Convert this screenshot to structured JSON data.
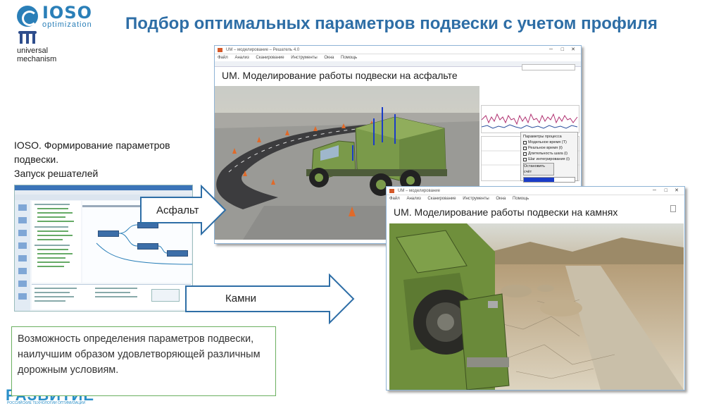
{
  "header": {
    "title": "Подбор оптимальных параметров подвески с учетом профиля",
    "ioso_logo_name": "IOSO",
    "ioso_logo_sub": "optimization",
    "um_logo_text": [
      "universal",
      "mechanism"
    ]
  },
  "left": {
    "caption": [
      "IOSO. Формирование параметров",
      "подвески.",
      "Запуск решателей"
    ]
  },
  "arrows": {
    "asphalt_label": "Асфальт",
    "stones_label": "Камни"
  },
  "window_asphalt": {
    "titlebar": "UM – моделирование – Решатель 4.0",
    "menu": [
      "Файл",
      "Анализ",
      "Сканирование",
      "Инструменты",
      "Окна",
      "Помощь"
    ],
    "banner": "UM. Моделирование работы подвески на асфальте",
    "panel_title": "Параметры процесса",
    "panel_items": [
      "Модельное время (T)",
      "Реальное время (t)",
      "Длительность шага (i)",
      "Шаг интегрирования (i)"
    ],
    "stop_button": "Остановить счёт",
    "progress_percent": 60,
    "progress_text": "60%"
  },
  "window_stones": {
    "titlebar": "UM – моделирование",
    "menu": [
      "Файл",
      "Анализ",
      "Сканирование",
      "Инструменты",
      "Окна",
      "Помощь"
    ],
    "banner": "UM. Моделирование работы подвески на камнях"
  },
  "note": {
    "text": "Возможность определения параметров подвески, наилучшим образом удовлетворяющей различным дорожным условиям."
  },
  "footer": {
    "logo": "РАЗВИТИЕ",
    "sub": "РОССИЙСКИЕ ТЕХНОЛОГИИ ОПТИМИЗАЦИИ"
  },
  "colors": {
    "title": "#2e6ea6",
    "accent": "#2a7fb8",
    "note_border": "#6bb060",
    "truck": "#7a9a4a"
  }
}
